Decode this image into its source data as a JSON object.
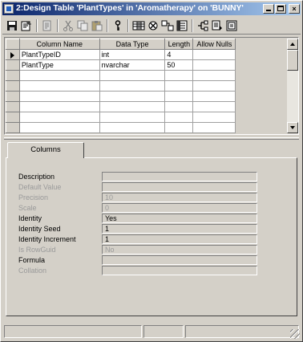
{
  "window": {
    "title": "2:Design Table 'PlantTypes' in 'Aromatherapy' on 'BUNNY'"
  },
  "title_buttons": {
    "close_label": "×"
  },
  "toolbar": {
    "icons": [
      "save-icon",
      "properties-icon",
      "generate-script-icon",
      "cut-icon",
      "copy-icon",
      "paste-icon",
      "set-primary-key-icon",
      "insert-column-icon",
      "delete-column-icon",
      "manage-relationships-icon",
      "manage-indexes-icon",
      "manage-constraints-icon",
      "manage-triggers-icon",
      "manage-keys-icon"
    ]
  },
  "grid": {
    "headers": {
      "column_name": "Column Name",
      "data_type": "Data Type",
      "length": "Length",
      "allow_nulls": "Allow Nulls"
    },
    "rows": [
      {
        "column_name": "PlantTypeID",
        "data_type": "int",
        "length": "4",
        "allow_nulls": ""
      },
      {
        "column_name": "PlantType",
        "data_type": "nvarchar",
        "length": "50",
        "allow_nulls": ""
      }
    ]
  },
  "tabs": {
    "columns_label": "Columns"
  },
  "properties": {
    "description": {
      "label": "Description",
      "value": ""
    },
    "default_value": {
      "label": "Default Value",
      "value": ""
    },
    "precision": {
      "label": "Precision",
      "value": "10"
    },
    "scale": {
      "label": "Scale",
      "value": "0"
    },
    "identity": {
      "label": "Identity",
      "value": "Yes"
    },
    "identity_seed": {
      "label": "Identity Seed",
      "value": "1"
    },
    "identity_increment": {
      "label": "Identity Increment",
      "value": "1"
    },
    "is_rowguid": {
      "label": "Is RowGuid",
      "value": "No"
    },
    "formula": {
      "label": "Formula",
      "value": ""
    },
    "collation": {
      "label": "Collation",
      "value": ""
    }
  }
}
